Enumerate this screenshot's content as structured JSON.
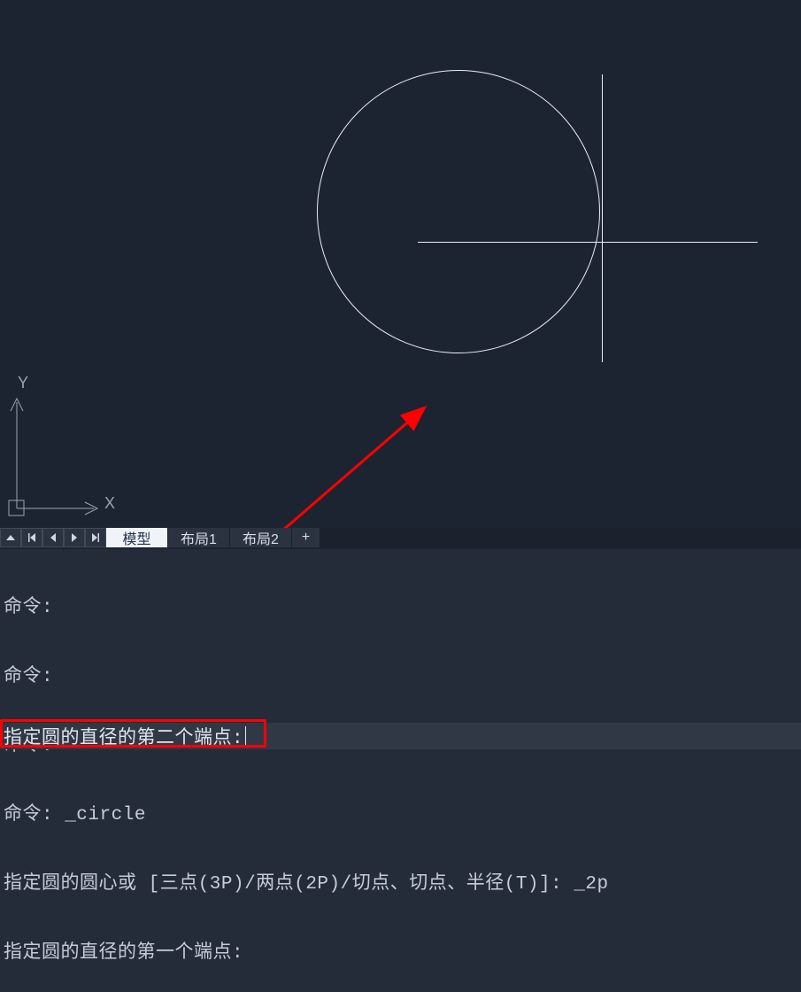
{
  "ucs": {
    "x_label": "X",
    "y_label": "Y"
  },
  "tabs": {
    "model": "模型",
    "layout1": "布局1",
    "layout2": "布局2",
    "add": "+"
  },
  "history": {
    "l1": "命令:",
    "l2": "命令:",
    "l3": "命令:",
    "l4": "命令: _circle",
    "l5": "指定圆的圆心或 [三点(3P)/两点(2P)/切点、切点、半径(T)]: _2p",
    "l6": "指定圆的直径的第一个端点:"
  },
  "prompt": {
    "text": "指定圆的直径的第二个端点:"
  }
}
